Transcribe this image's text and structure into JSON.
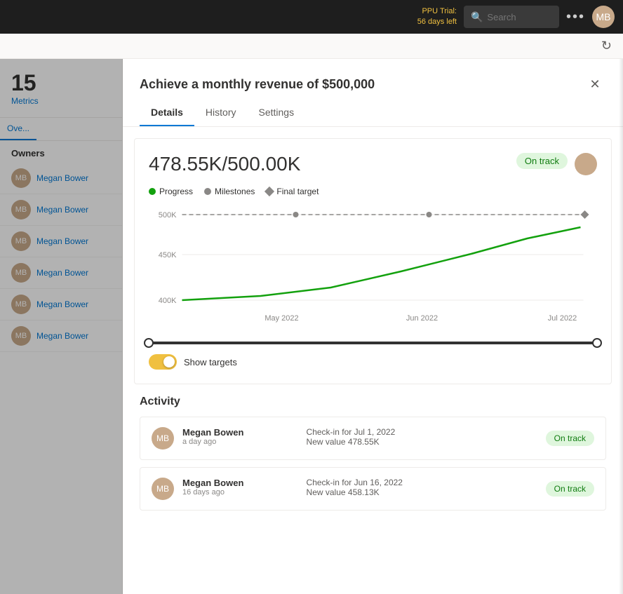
{
  "topbar": {
    "ppu_trial_label": "PPU Trial:",
    "ppu_trial_days": "56 days left",
    "search_placeholder": "Search",
    "more_icon": "•••",
    "avatar_initials": "MB"
  },
  "refresh_icon": "↻",
  "sidebar": {
    "metrics_number": "15",
    "metrics_label": "Metrics",
    "tabs": [
      {
        "label": "Ove..."
      }
    ],
    "owners_header": "Owners",
    "owners": [
      {
        "name": "Megan Bower"
      },
      {
        "name": "Megan Bower"
      },
      {
        "name": "Megan Bower"
      },
      {
        "name": "Megan Bower"
      },
      {
        "name": "Megan Bower"
      },
      {
        "name": "Megan Bower"
      }
    ]
  },
  "modal": {
    "title": "Achieve a monthly revenue of $500,000",
    "close_icon": "✕",
    "tabs": [
      {
        "label": "Details",
        "active": true
      },
      {
        "label": "History",
        "active": false
      },
      {
        "label": "Settings",
        "active": false
      }
    ],
    "chart": {
      "current_value": "478.55K",
      "target_value": "/500.00K",
      "status_badge": "On track",
      "legend": [
        {
          "type": "green-dot",
          "label": "Progress"
        },
        {
          "type": "gray-dot",
          "label": "Milestones"
        },
        {
          "type": "diamond",
          "label": "Final target"
        }
      ],
      "y_labels": [
        "500K",
        "450K",
        "400K"
      ],
      "x_labels": [
        "May 2022",
        "Jun 2022",
        "Jul 2022"
      ],
      "show_targets_label": "Show targets"
    },
    "activity": {
      "title": "Activity",
      "items": [
        {
          "name": "Megan Bowen",
          "time": "a day ago",
          "detail_line1": "Check-in for Jul 1, 2022",
          "detail_line2": "New value 478.55K",
          "badge": "On track",
          "avatar_initials": "MB"
        },
        {
          "name": "Megan Bowen",
          "time": "16 days ago",
          "detail_line1": "Check-in for Jun 16, 2022",
          "detail_line2": "New value 458.13K",
          "badge": "On track",
          "avatar_initials": "MB"
        }
      ]
    }
  }
}
